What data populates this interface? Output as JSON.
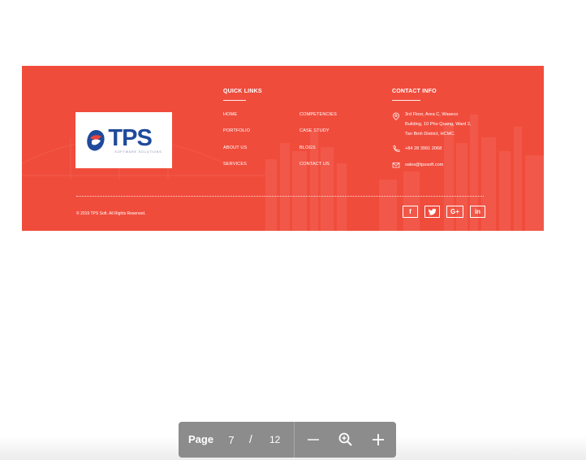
{
  "footer": {
    "logo": {
      "word": "TPS",
      "tagline": "SOFTWARE SOLUTIONS"
    },
    "quick_links": {
      "title": "QUICK LINKS",
      "col1": [
        "HOME",
        "PORTFOLIO",
        "ABOUT US",
        "SERVICES"
      ],
      "col2": [
        "COMPETENCIES",
        "CASE STUDY",
        "BLOGS",
        "CONTACT US"
      ]
    },
    "contact": {
      "title": "CONTACT INFO",
      "address_lines": [
        "3rd Floor, Area C, Waseco",
        "Building, 10 Pho Quang, Ward 2,",
        "Tan Binh District, HCMC."
      ],
      "phone": "+84 28 3991 2068",
      "email": "sales@tpssoft.com"
    },
    "copyright": "© 2019 TPS Soft. All Rights Reserved.",
    "social": [
      {
        "name": "facebook",
        "glyph": "f"
      },
      {
        "name": "twitter",
        "glyph": "t"
      },
      {
        "name": "google-plus",
        "glyph": "G+"
      },
      {
        "name": "linkedin",
        "glyph": "in"
      }
    ],
    "colors": {
      "background": "#f04c3c",
      "logo_blue": "#1f4a9b",
      "logo_red": "#e8453c"
    }
  },
  "pagebar": {
    "page_label": "Page",
    "current_page": "7",
    "separator": "/",
    "total_pages": "12",
    "icons": [
      "zoom-out-icon",
      "zoom-search-icon",
      "zoom-in-icon"
    ]
  }
}
